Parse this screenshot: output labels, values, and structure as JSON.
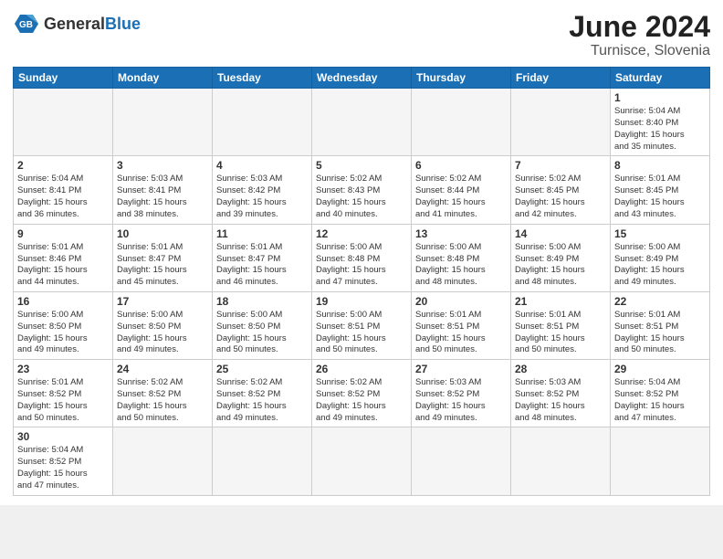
{
  "header": {
    "logo_general": "General",
    "logo_blue": "Blue",
    "month_title": "June 2024",
    "location": "Turnisce, Slovenia"
  },
  "days_of_week": [
    "Sunday",
    "Monday",
    "Tuesday",
    "Wednesday",
    "Thursday",
    "Friday",
    "Saturday"
  ],
  "weeks": [
    [
      {
        "day": "",
        "info": ""
      },
      {
        "day": "",
        "info": ""
      },
      {
        "day": "",
        "info": ""
      },
      {
        "day": "",
        "info": ""
      },
      {
        "day": "",
        "info": ""
      },
      {
        "day": "",
        "info": ""
      },
      {
        "day": "1",
        "info": "Sunrise: 5:04 AM\nSunset: 8:40 PM\nDaylight: 15 hours\nand 35 minutes."
      }
    ],
    [
      {
        "day": "2",
        "info": "Sunrise: 5:04 AM\nSunset: 8:41 PM\nDaylight: 15 hours\nand 36 minutes."
      },
      {
        "day": "3",
        "info": "Sunrise: 5:03 AM\nSunset: 8:41 PM\nDaylight: 15 hours\nand 38 minutes."
      },
      {
        "day": "4",
        "info": "Sunrise: 5:03 AM\nSunset: 8:42 PM\nDaylight: 15 hours\nand 39 minutes."
      },
      {
        "day": "5",
        "info": "Sunrise: 5:02 AM\nSunset: 8:43 PM\nDaylight: 15 hours\nand 40 minutes."
      },
      {
        "day": "6",
        "info": "Sunrise: 5:02 AM\nSunset: 8:44 PM\nDaylight: 15 hours\nand 41 minutes."
      },
      {
        "day": "7",
        "info": "Sunrise: 5:02 AM\nSunset: 8:45 PM\nDaylight: 15 hours\nand 42 minutes."
      },
      {
        "day": "8",
        "info": "Sunrise: 5:01 AM\nSunset: 8:45 PM\nDaylight: 15 hours\nand 43 minutes."
      }
    ],
    [
      {
        "day": "9",
        "info": "Sunrise: 5:01 AM\nSunset: 8:46 PM\nDaylight: 15 hours\nand 44 minutes."
      },
      {
        "day": "10",
        "info": "Sunrise: 5:01 AM\nSunset: 8:47 PM\nDaylight: 15 hours\nand 45 minutes."
      },
      {
        "day": "11",
        "info": "Sunrise: 5:01 AM\nSunset: 8:47 PM\nDaylight: 15 hours\nand 46 minutes."
      },
      {
        "day": "12",
        "info": "Sunrise: 5:00 AM\nSunset: 8:48 PM\nDaylight: 15 hours\nand 47 minutes."
      },
      {
        "day": "13",
        "info": "Sunrise: 5:00 AM\nSunset: 8:48 PM\nDaylight: 15 hours\nand 48 minutes."
      },
      {
        "day": "14",
        "info": "Sunrise: 5:00 AM\nSunset: 8:49 PM\nDaylight: 15 hours\nand 48 minutes."
      },
      {
        "day": "15",
        "info": "Sunrise: 5:00 AM\nSunset: 8:49 PM\nDaylight: 15 hours\nand 49 minutes."
      }
    ],
    [
      {
        "day": "16",
        "info": "Sunrise: 5:00 AM\nSunset: 8:50 PM\nDaylight: 15 hours\nand 49 minutes."
      },
      {
        "day": "17",
        "info": "Sunrise: 5:00 AM\nSunset: 8:50 PM\nDaylight: 15 hours\nand 49 minutes."
      },
      {
        "day": "18",
        "info": "Sunrise: 5:00 AM\nSunset: 8:50 PM\nDaylight: 15 hours\nand 50 minutes."
      },
      {
        "day": "19",
        "info": "Sunrise: 5:00 AM\nSunset: 8:51 PM\nDaylight: 15 hours\nand 50 minutes."
      },
      {
        "day": "20",
        "info": "Sunrise: 5:01 AM\nSunset: 8:51 PM\nDaylight: 15 hours\nand 50 minutes."
      },
      {
        "day": "21",
        "info": "Sunrise: 5:01 AM\nSunset: 8:51 PM\nDaylight: 15 hours\nand 50 minutes."
      },
      {
        "day": "22",
        "info": "Sunrise: 5:01 AM\nSunset: 8:51 PM\nDaylight: 15 hours\nand 50 minutes."
      }
    ],
    [
      {
        "day": "23",
        "info": "Sunrise: 5:01 AM\nSunset: 8:52 PM\nDaylight: 15 hours\nand 50 minutes."
      },
      {
        "day": "24",
        "info": "Sunrise: 5:02 AM\nSunset: 8:52 PM\nDaylight: 15 hours\nand 50 minutes."
      },
      {
        "day": "25",
        "info": "Sunrise: 5:02 AM\nSunset: 8:52 PM\nDaylight: 15 hours\nand 49 minutes."
      },
      {
        "day": "26",
        "info": "Sunrise: 5:02 AM\nSunset: 8:52 PM\nDaylight: 15 hours\nand 49 minutes."
      },
      {
        "day": "27",
        "info": "Sunrise: 5:03 AM\nSunset: 8:52 PM\nDaylight: 15 hours\nand 49 minutes."
      },
      {
        "day": "28",
        "info": "Sunrise: 5:03 AM\nSunset: 8:52 PM\nDaylight: 15 hours\nand 48 minutes."
      },
      {
        "day": "29",
        "info": "Sunrise: 5:04 AM\nSunset: 8:52 PM\nDaylight: 15 hours\nand 47 minutes."
      }
    ],
    [
      {
        "day": "30",
        "info": "Sunrise: 5:04 AM\nSunset: 8:52 PM\nDaylight: 15 hours\nand 47 minutes."
      },
      {
        "day": "",
        "info": ""
      },
      {
        "day": "",
        "info": ""
      },
      {
        "day": "",
        "info": ""
      },
      {
        "day": "",
        "info": ""
      },
      {
        "day": "",
        "info": ""
      },
      {
        "day": "",
        "info": ""
      }
    ]
  ]
}
